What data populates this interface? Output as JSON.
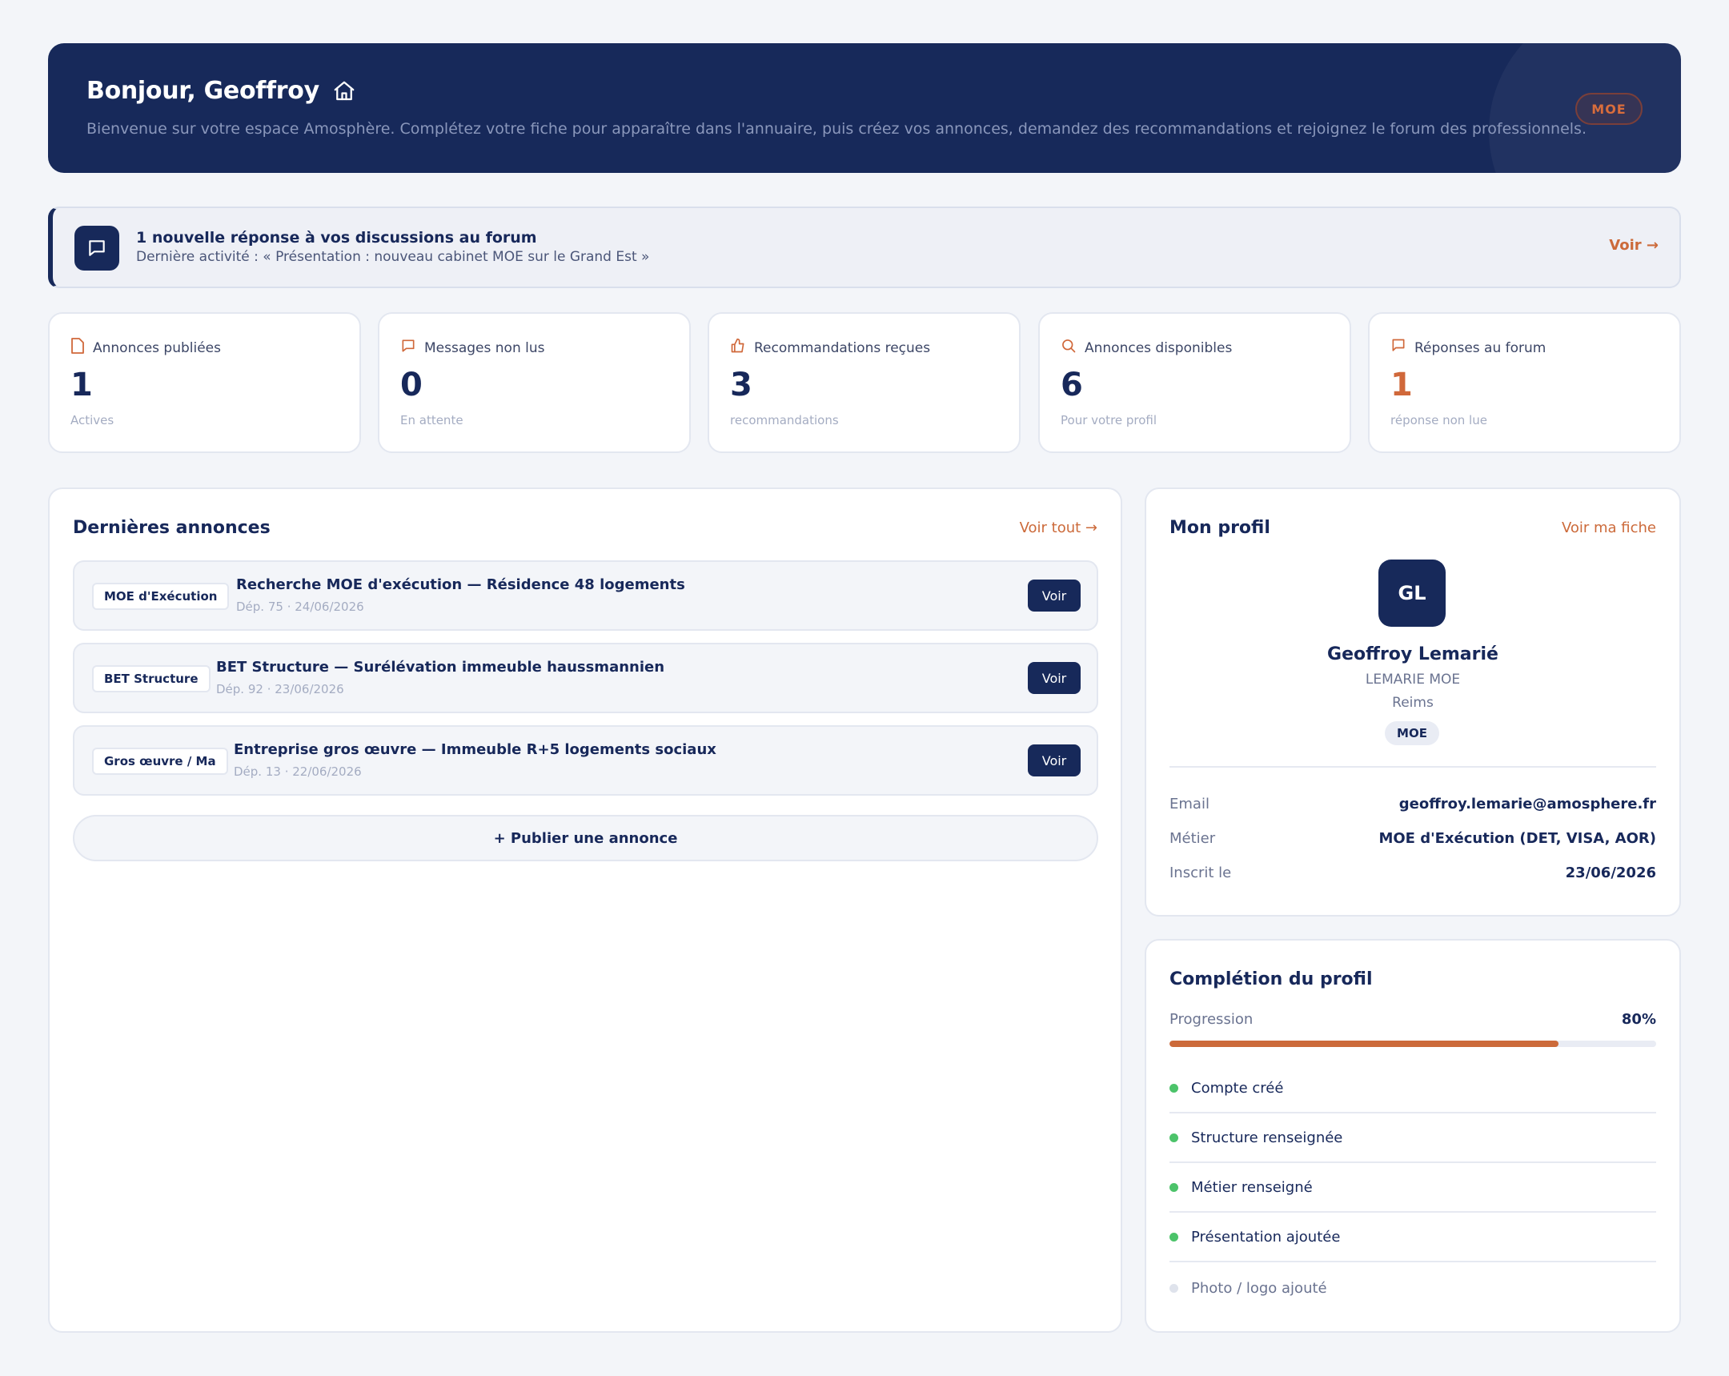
{
  "hero": {
    "title": "Bonjour, Geoffroy",
    "subtitle": "Bienvenue sur votre espace Amosphère. Complétez votre fiche pour apparaître dans l'annuaire, puis créez vos annonces, demandez des recommandations et rejoignez le forum des professionnels.",
    "role_badge": "MOE",
    "icon": "home-icon"
  },
  "forum_alert": {
    "title": "1 nouvelle réponse à vos discussions au forum",
    "subtitle": "Dernière activité : « Présentation : nouveau cabinet MOE sur le Grand Est »",
    "link": "Voir →",
    "icon": "chat-icon"
  },
  "stats": [
    {
      "label": "Annonces publiées",
      "value": "1",
      "note": "Actives",
      "icon": "document-icon"
    },
    {
      "label": "Messages non lus",
      "value": "0",
      "note": "En attente",
      "icon": "message-icon"
    },
    {
      "label": "Recommandations reçues",
      "value": "3",
      "note": "recommandations",
      "icon": "thumbs-up-icon"
    },
    {
      "label": "Annonces disponibles",
      "value": "6",
      "note": "Pour votre profil",
      "icon": "search-icon"
    },
    {
      "label": "Réponses au forum",
      "value": "1",
      "note": "réponse non lue",
      "icon": "flag-icon"
    }
  ],
  "announcements": {
    "title": "Dernières annonces",
    "see_all": "Voir tout →",
    "items": [
      {
        "tag": "MOE d'Exécution",
        "title": "Recherche MOE d'exécution — Résidence 48 logements",
        "meta": "Dép. 75 · 24/06/2026",
        "action": "Voir"
      },
      {
        "tag": "BET Structure",
        "title": "BET Structure — Surélévation immeuble haussmannien",
        "meta": "Dép. 92 · 23/06/2026",
        "action": "Voir"
      },
      {
        "tag": "Gros œuvre / Ma",
        "title": "Entreprise gros œuvre — Immeuble R+5 logements sociaux",
        "meta": "Dép. 13 · 22/06/2026",
        "action": "Voir"
      }
    ],
    "publish_button": "+ Publier une annonce"
  },
  "profile": {
    "title": "Mon profil",
    "link": "Voir ma fiche",
    "initials": "GL",
    "name": "Geoffroy Lemarié",
    "company": "LEMARIE MOE",
    "city": "Reims",
    "badge": "MOE",
    "rows": [
      {
        "label": "Email",
        "value": "geoffroy.lemarie@amosphere.fr"
      },
      {
        "label": "Métier",
        "value": "MOE d'Exécution (DET, VISA, AOR)"
      },
      {
        "label": "Inscrit le",
        "value": "23/06/2026"
      }
    ]
  },
  "completion": {
    "title": "Complétion du profil",
    "progress_label": "Progression",
    "progress_text": "80%",
    "progress_value": 0.8,
    "items": [
      {
        "label": "Compte créé",
        "done": true
      },
      {
        "label": "Structure renseignée",
        "done": true
      },
      {
        "label": "Métier renseigné",
        "done": true
      },
      {
        "label": "Présentation ajoutée",
        "done": true
      },
      {
        "label": "Photo / logo ajouté",
        "done": false
      }
    ]
  },
  "colors": {
    "navy": "#17295a",
    "accent": "#cc6a3a",
    "done": "#4cc36a",
    "background": "#f3f5f9"
  }
}
